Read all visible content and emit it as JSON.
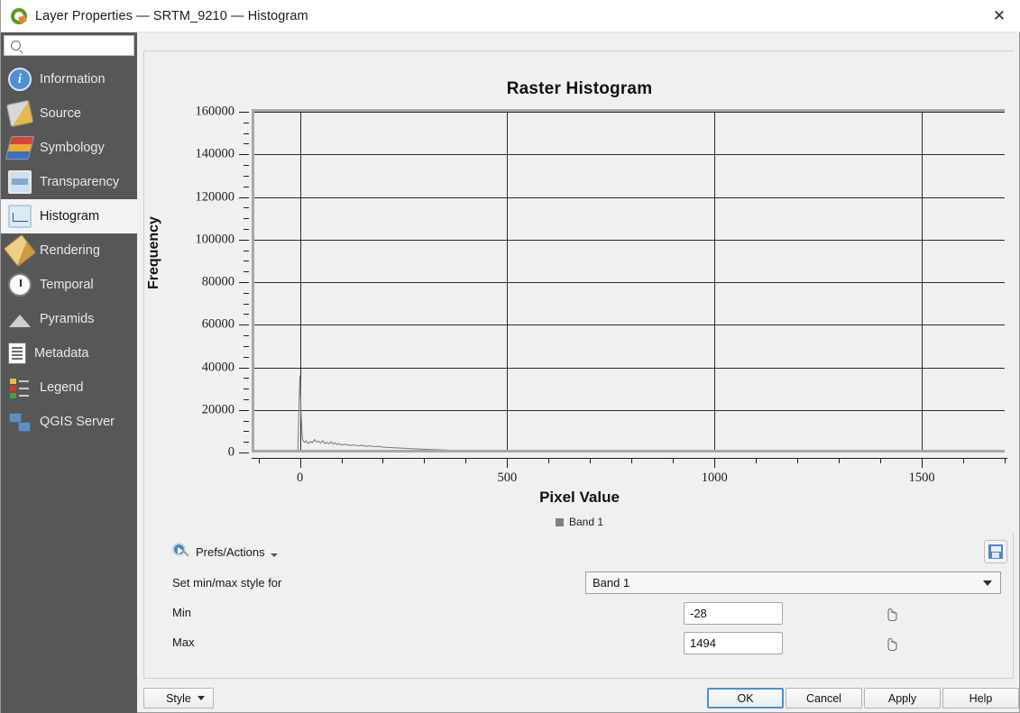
{
  "window": {
    "title": "Layer Properties — SRTM_9210 — Histogram",
    "logo_icon": "qgis-logo-icon",
    "close_icon": "close-icon"
  },
  "sidebar": {
    "search": {
      "value": "",
      "placeholder": "",
      "icon": "search-icon"
    },
    "items": [
      {
        "label": "Information",
        "icon": "information-icon",
        "active": false
      },
      {
        "label": "Source",
        "icon": "source-icon",
        "active": false
      },
      {
        "label": "Symbology",
        "icon": "symbology-icon",
        "active": false
      },
      {
        "label": "Transparency",
        "icon": "transparency-icon",
        "active": false
      },
      {
        "label": "Histogram",
        "icon": "histogram-icon",
        "active": true
      },
      {
        "label": "Rendering",
        "icon": "rendering-icon",
        "active": false
      },
      {
        "label": "Temporal",
        "icon": "clock-icon",
        "active": false
      },
      {
        "label": "Pyramids",
        "icon": "pyramids-icon",
        "active": false
      },
      {
        "label": "Metadata",
        "icon": "metadata-icon",
        "active": false
      },
      {
        "label": "Legend",
        "icon": "legend-icon",
        "active": false
      },
      {
        "label": "QGIS Server",
        "icon": "server-icon",
        "active": false
      }
    ]
  },
  "chart_data": {
    "type": "line",
    "title": "Raster Histogram",
    "xlabel": "Pixel Value",
    "ylabel": "Frequency",
    "xlim": [
      -110,
      1700
    ],
    "ylim": [
      0,
      160000
    ],
    "xticks": [
      0,
      500,
      1000,
      1500
    ],
    "xtick_labels": [
      "0",
      "500",
      "1000",
      "1500"
    ],
    "xminor_step": 100,
    "yticks": [
      0,
      20000,
      40000,
      60000,
      80000,
      100000,
      120000,
      140000,
      160000
    ],
    "ytick_labels": [
      "0",
      "20000",
      "40000",
      "60000",
      "80000",
      "100000",
      "120000",
      "140000",
      "160000"
    ],
    "yminor_step": 5000,
    "grid": true,
    "legend_position": "bottom",
    "series": [
      {
        "name": "Band 1",
        "color": "#808080",
        "x": [
          -28,
          -20,
          -10,
          -5,
          0,
          3,
          6,
          9,
          12,
          15,
          20,
          25,
          30,
          35,
          40,
          45,
          50,
          55,
          60,
          65,
          70,
          75,
          80,
          85,
          90,
          95,
          100,
          110,
          120,
          130,
          140,
          150,
          160,
          170,
          180,
          190,
          200,
          220,
          240,
          260,
          280,
          300,
          330,
          360,
          400,
          450,
          500,
          560,
          620,
          680,
          740,
          800,
          860,
          920,
          980,
          1040,
          1100,
          1200,
          1300,
          1400,
          1494
        ],
        "values": [
          120,
          150,
          200,
          900,
          36000,
          17000,
          6400,
          5200,
          4700,
          5400,
          4300,
          5100,
          4600,
          6000,
          4900,
          5300,
          4400,
          5600,
          4200,
          4800,
          4100,
          5000,
          3900,
          4600,
          3700,
          4200,
          3500,
          3900,
          3300,
          3600,
          3100,
          3400,
          2900,
          3100,
          2700,
          2900,
          2500,
          2300,
          2100,
          1900,
          1700,
          1500,
          1300,
          1100,
          950,
          800,
          700,
          640,
          600,
          560,
          520,
          500,
          470,
          440,
          400,
          360,
          320,
          240,
          170,
          110,
          60
        ]
      }
    ]
  },
  "controls": {
    "prefs_actions": {
      "label": "Prefs/Actions",
      "icon": "prefs-actions-icon",
      "caret_icon": "chevron-down-icon"
    },
    "save_button": {
      "icon": "save-icon"
    },
    "minmax_style_label": "Set min/max style for",
    "band_select": {
      "value": "Band 1",
      "caret_icon": "chevron-down-icon"
    },
    "min": {
      "label": "Min",
      "value": "-28",
      "picker_icon": "hand-pointer-icon"
    },
    "max": {
      "label": "Max",
      "value": "1494",
      "picker_icon": "hand-pointer-icon"
    }
  },
  "footer": {
    "style_button": {
      "label": "Style",
      "caret_icon": "chevron-down-icon"
    },
    "buttons": [
      {
        "label": "OK",
        "primary": true
      },
      {
        "label": "Cancel",
        "primary": false
      },
      {
        "label": "Apply",
        "primary": false
      },
      {
        "label": "Help",
        "primary": false
      }
    ]
  }
}
